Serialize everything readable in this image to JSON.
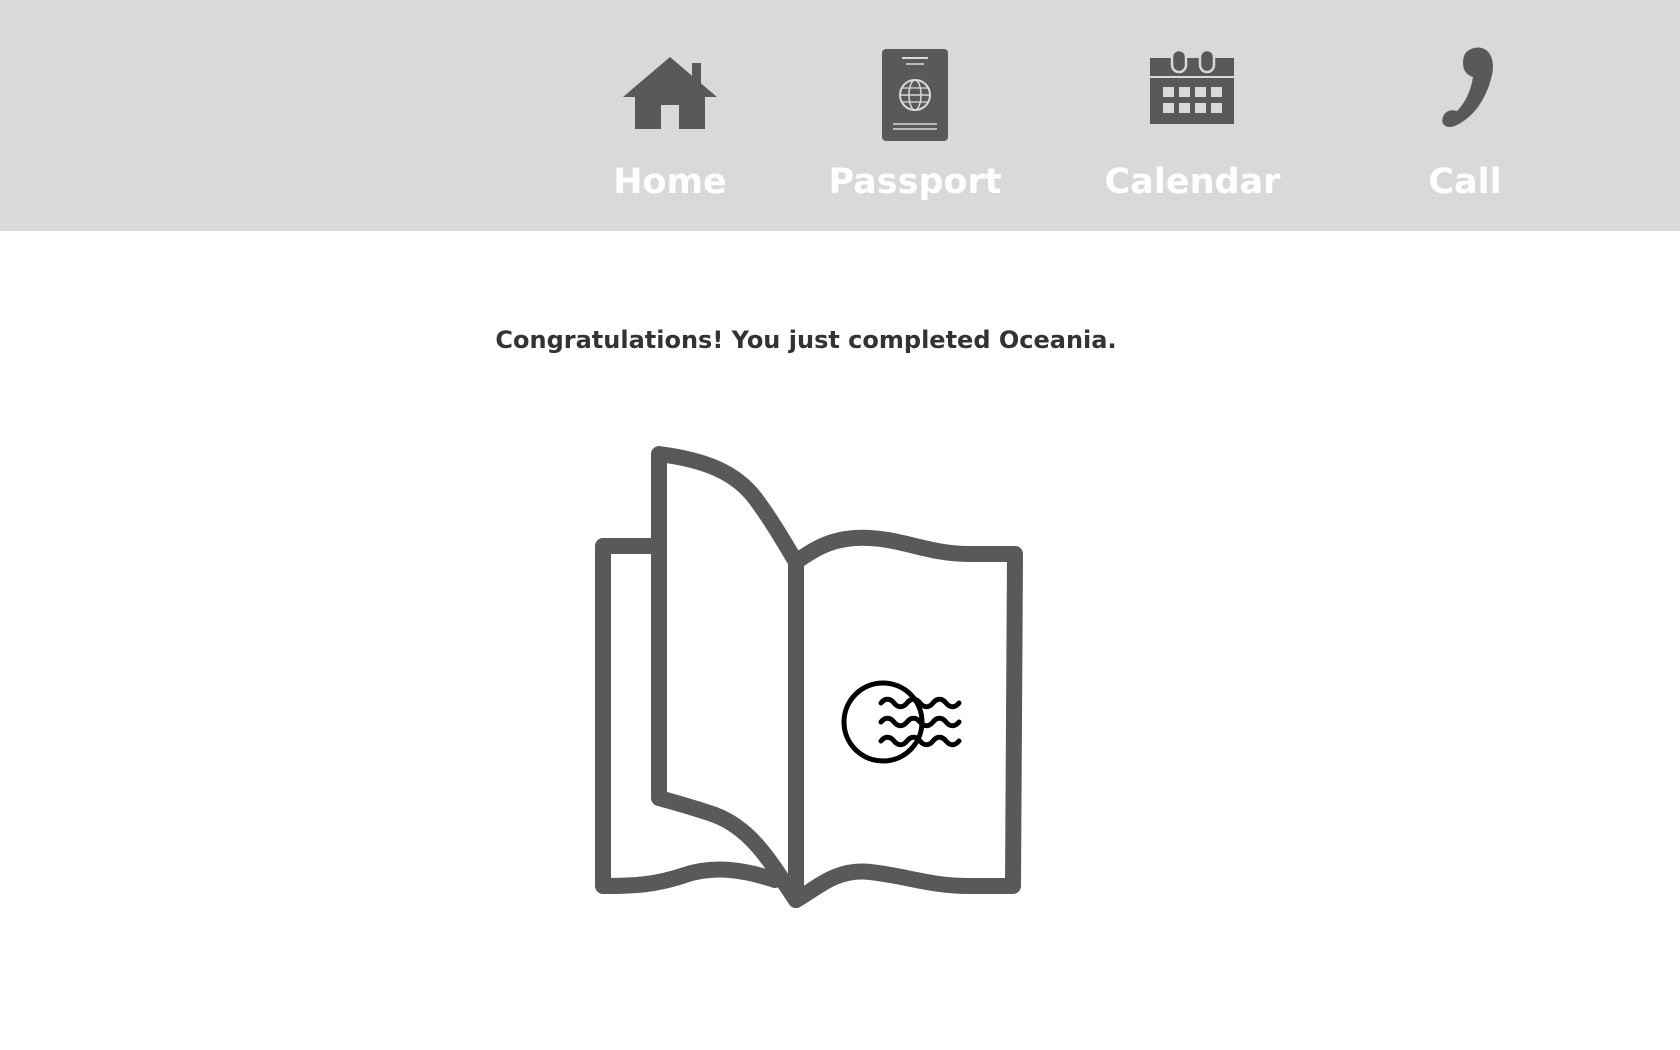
{
  "nav": {
    "items": [
      {
        "label": "Home",
        "icon": "house-icon"
      },
      {
        "label": "Passport",
        "icon": "passport-icon"
      },
      {
        "label": "Calendar",
        "icon": "calendar-icon"
      },
      {
        "label": "Call",
        "icon": "phone-icon"
      }
    ]
  },
  "main": {
    "message": "Congratulations! You just completed Oceania.",
    "illustration": {
      "name": "open-passport-book",
      "stamp_icon": "ocean-waves-stamp-icon"
    }
  },
  "colors": {
    "topbar_background": "#d9d9d9",
    "icon_fill": "#595959",
    "nav_label": "#ffffff",
    "message_text": "#333333",
    "book_stroke": "#595959",
    "stamp_stroke": "#000000"
  }
}
